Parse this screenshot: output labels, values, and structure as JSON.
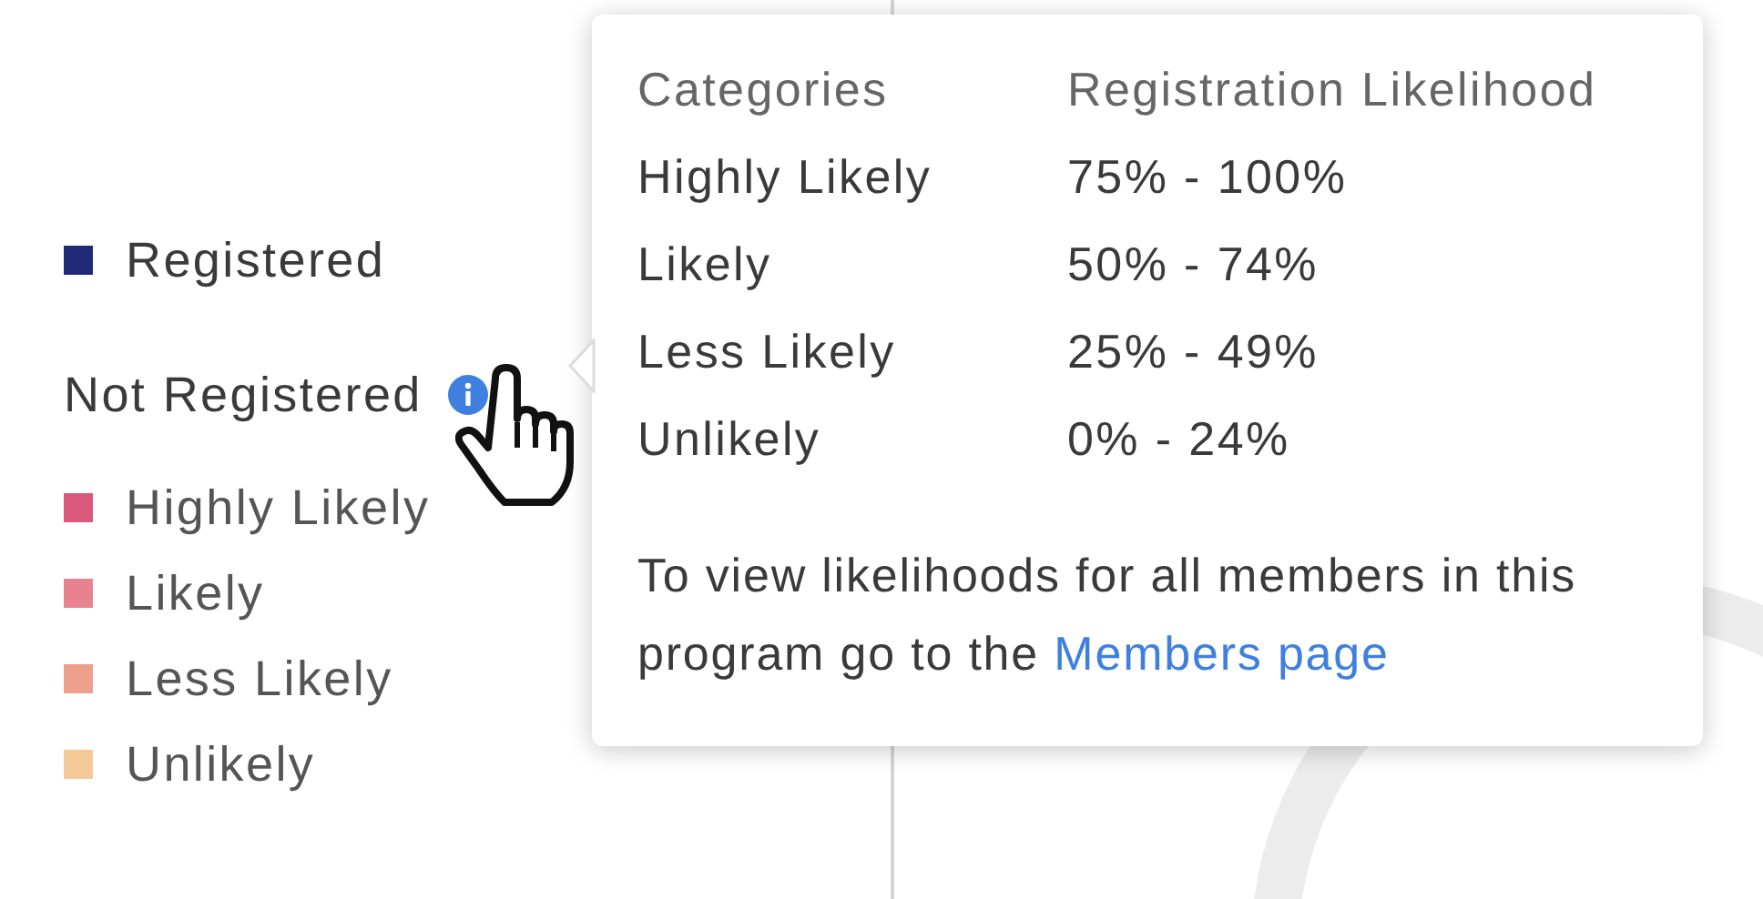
{
  "legend": {
    "registered": {
      "label": "Registered",
      "color": "#1e2a78"
    },
    "not_registered": {
      "label": "Not Registered"
    },
    "items": [
      {
        "label": "Highly Likely",
        "color": "#d9587c"
      },
      {
        "label": "Likely",
        "color": "#e8828f"
      },
      {
        "label": "Less Likely",
        "color": "#eda08c"
      },
      {
        "label": "Unlikely",
        "color": "#f5c898"
      }
    ]
  },
  "tooltip": {
    "columns": [
      "Categories",
      "Registration Likelihood"
    ],
    "rows": [
      {
        "category": "Highly Likely",
        "range": "75% - 100%"
      },
      {
        "category": "Likely",
        "range": "50% - 74%"
      },
      {
        "category": "Less Likely",
        "range": "25% - 49%"
      },
      {
        "category": "Unlikely",
        "range": "0% - 24%"
      }
    ],
    "note": "To view likelihoods for all members in this program go to the",
    "link": "Members page"
  }
}
